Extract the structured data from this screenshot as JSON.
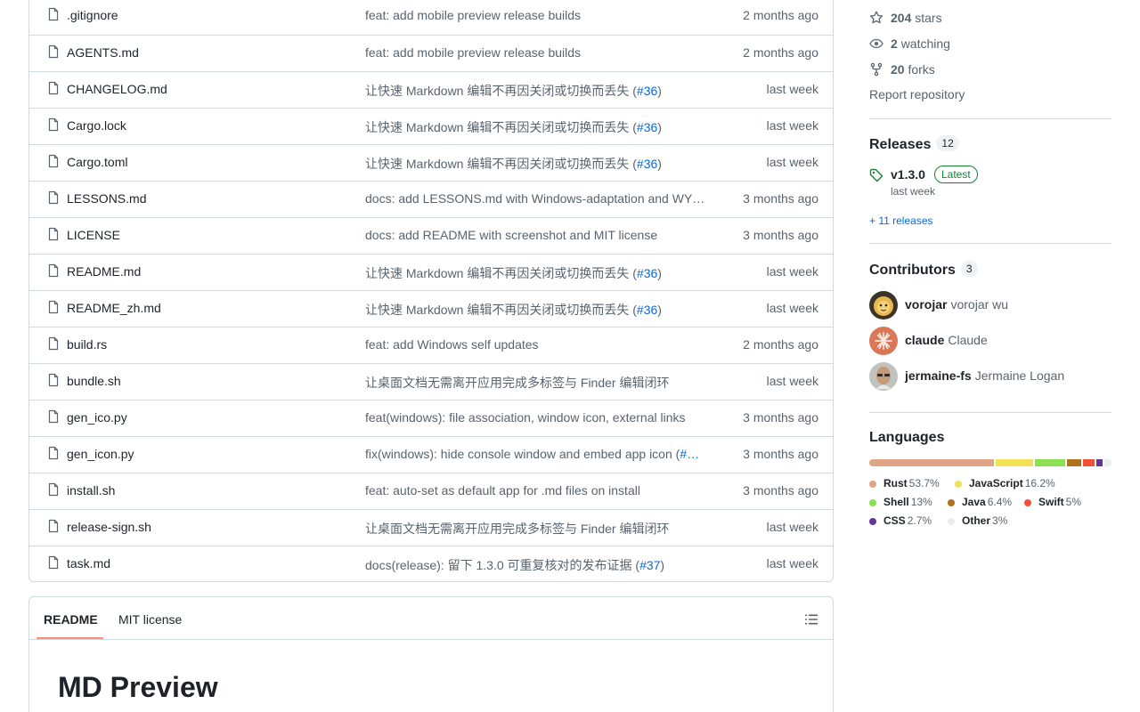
{
  "files": [
    {
      "name": ".gitignore",
      "message": "feat: add mobile preview release builds",
      "date": "2 months ago"
    },
    {
      "name": "AGENTS.md",
      "message": "feat: add mobile preview release builds",
      "date": "2 months ago"
    },
    {
      "name": "CHANGELOG.md",
      "message": "让快速 Markdown 编辑不再因关闭或切换而丢失 (",
      "link": "#36",
      "suffix": ")",
      "date": "last week"
    },
    {
      "name": "Cargo.lock",
      "message": "让快速 Markdown 编辑不再因关闭或切换而丢失 (",
      "link": "#36",
      "suffix": ")",
      "date": "last week"
    },
    {
      "name": "Cargo.toml",
      "message": "让快速 Markdown 编辑不再因关闭或切换而丢失 (",
      "link": "#36",
      "suffix": ")",
      "date": "last week"
    },
    {
      "name": "LESSONS.md",
      "message": "docs: add LESSONS.md with Windows-adaptation and WY…",
      "date": "3 months ago"
    },
    {
      "name": "LICENSE",
      "message": "docs: add README with screenshot and MIT license",
      "date": "3 months ago"
    },
    {
      "name": "README.md",
      "message": "让快速 Markdown 编辑不再因关闭或切换而丢失 (",
      "link": "#36",
      "suffix": ")",
      "date": "last week"
    },
    {
      "name": "README_zh.md",
      "message": "让快速 Markdown 编辑不再因关闭或切换而丢失 (",
      "link": "#36",
      "suffix": ")",
      "date": "last week"
    },
    {
      "name": "build.rs",
      "message": "feat: add Windows self updates",
      "date": "2 months ago"
    },
    {
      "name": "bundle.sh",
      "message": "让桌面文档无需离开应用完成多标签与 Finder 编辑闭环",
      "date": "last week"
    },
    {
      "name": "gen_ico.py",
      "message": "feat(windows): file association, window icon, external links",
      "date": "3 months ago"
    },
    {
      "name": "gen_icon.py",
      "message": "fix(windows): hide console window and embed app icon (",
      "link": "#…",
      "suffix": "",
      "date": "3 months ago"
    },
    {
      "name": "install.sh",
      "message": "feat: auto-set as default app for .md files on install",
      "date": "3 months ago"
    },
    {
      "name": "release-sign.sh",
      "message": "让桌面文档无需离开应用完成多标签与 Finder 编辑闭环",
      "date": "last week"
    },
    {
      "name": "task.md",
      "message": "docs(release): 留下 1.3.0 可重复核对的发布证据 (",
      "link": "#37",
      "suffix": ")",
      "date": "last week"
    }
  ],
  "readme": {
    "tabs": [
      "README",
      "MIT license"
    ],
    "title": "MD Preview"
  },
  "sidebar": {
    "stars_count": "204",
    "stars_label": "stars",
    "watching_count": "2",
    "watching_label": "watching",
    "forks_count": "20",
    "forks_label": "forks",
    "report": "Report repository",
    "releases_title": "Releases",
    "releases_count": "12",
    "release_name": "v1.3.0",
    "release_badge": "Latest",
    "release_date": "last week",
    "more_releases": "+ 11 releases",
    "contributors_title": "Contributors",
    "contributors_count": "3",
    "contributors": [
      {
        "login": "vorojar",
        "name": "vorojar wu"
      },
      {
        "login": "claude",
        "name": "Claude"
      },
      {
        "login": "jermaine-fs",
        "name": "Jermaine Logan"
      }
    ],
    "languages_title": "Languages",
    "languages": [
      {
        "name": "Rust",
        "percent": "53.7%",
        "value": 53.7,
        "color": "#dea584"
      },
      {
        "name": "JavaScript",
        "percent": "16.2%",
        "value": 16.2,
        "color": "#f1e05a"
      },
      {
        "name": "Shell",
        "percent": "13%",
        "value": 13,
        "color": "#89e051"
      },
      {
        "name": "Java",
        "percent": "6.4%",
        "value": 6.4,
        "color": "#b07219"
      },
      {
        "name": "Swift",
        "percent": "5%",
        "value": 5,
        "color": "#f05138"
      },
      {
        "name": "CSS",
        "percent": "2.7%",
        "value": 2.7,
        "color": "#663399"
      },
      {
        "name": "Other",
        "percent": "3%",
        "value": 3,
        "color": "#ededed"
      }
    ]
  }
}
